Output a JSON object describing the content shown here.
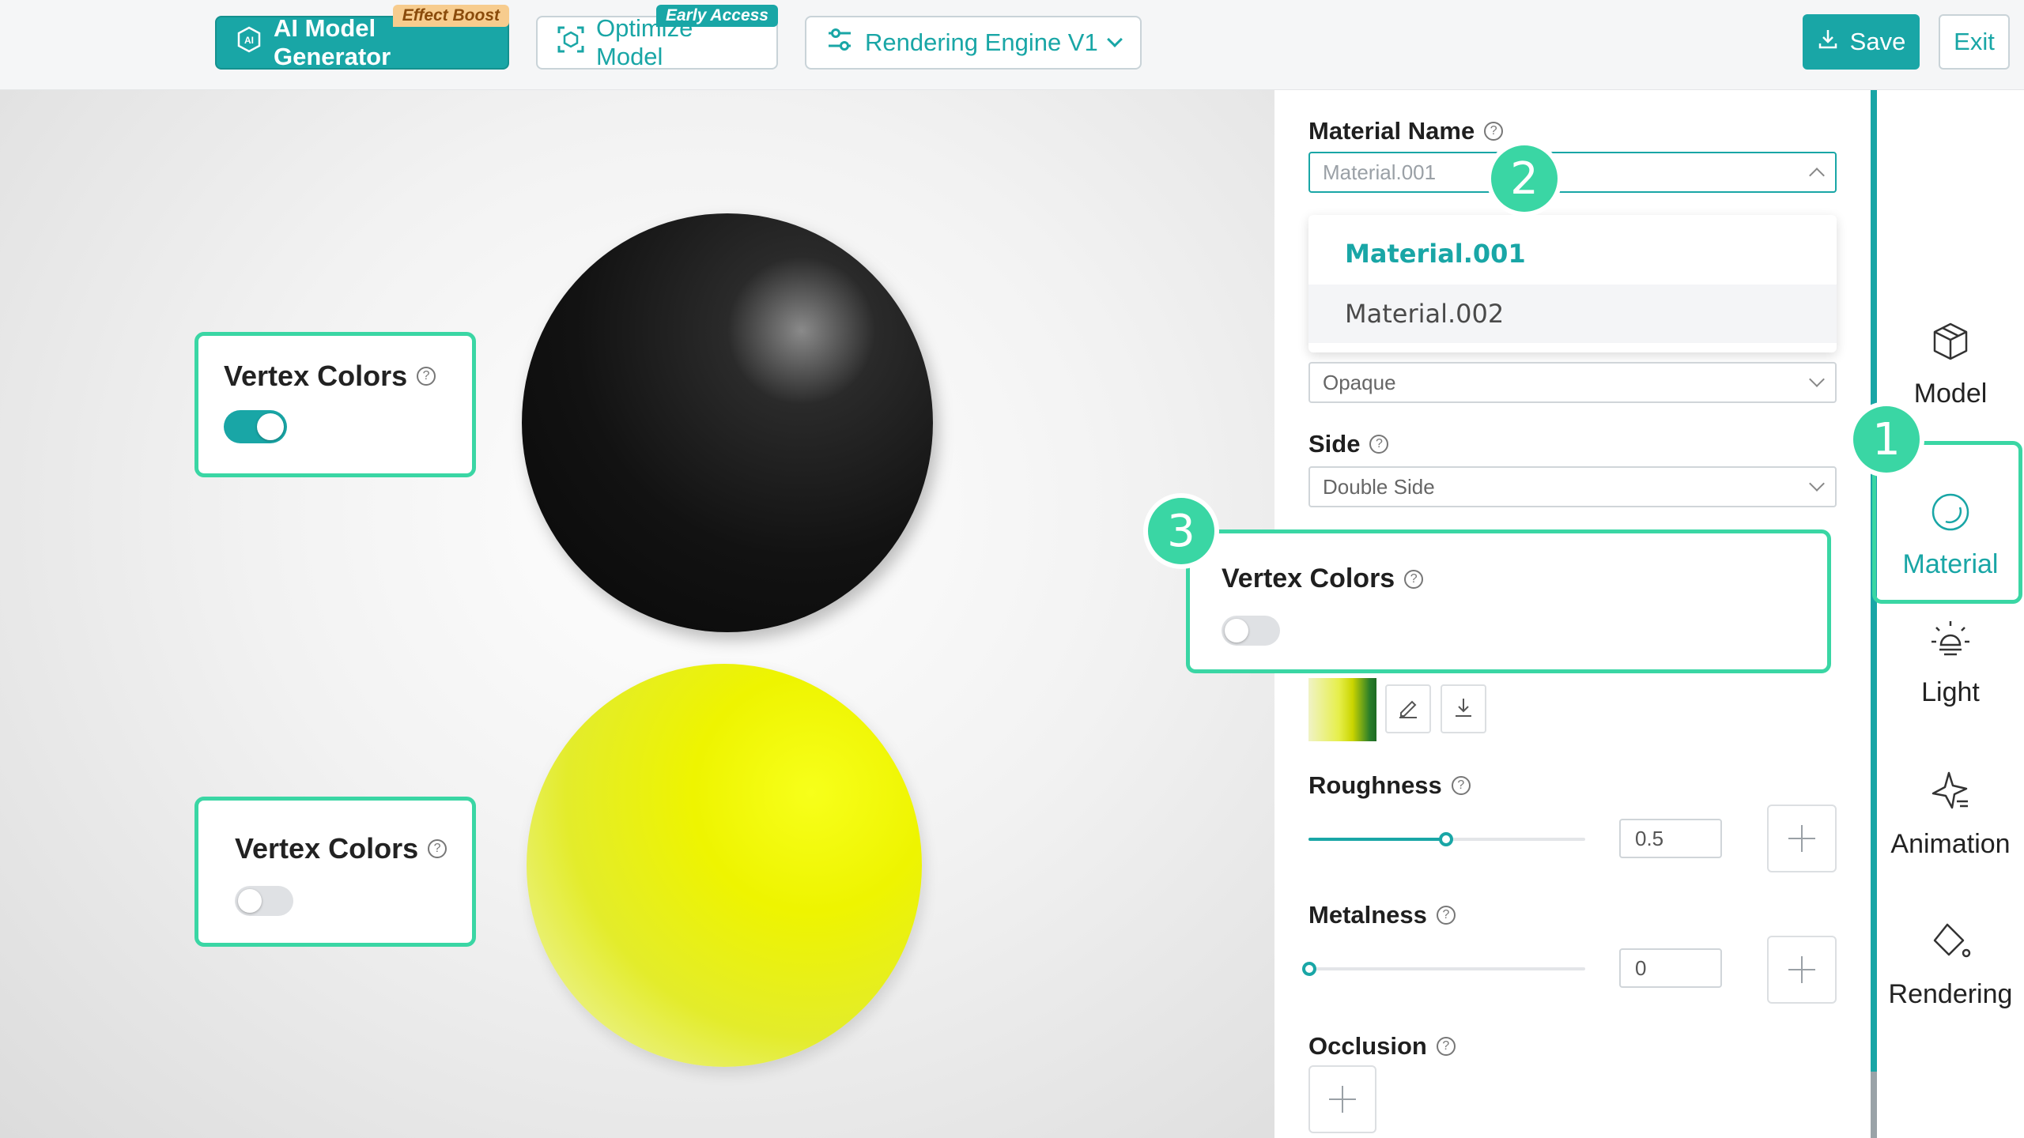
{
  "topbar": {
    "ai_generator_label": "AI Model Generator",
    "ai_generator_tag": "Effect Boost",
    "optimize_label": "Optimize Model",
    "optimize_tag": "Early Access",
    "engine_label": "Rendering Engine V1",
    "save_label": "Save",
    "exit_label": "Exit"
  },
  "viewport": {
    "card_top": {
      "title": "Vertex Colors",
      "enabled": true
    },
    "card_bottom": {
      "title": "Vertex Colors",
      "enabled": false
    }
  },
  "panel": {
    "material_name_label": "Material Name",
    "material_select_value": "Material.001",
    "material_options": [
      "Material.001",
      "Material.002"
    ],
    "blend_select_value": "Opaque",
    "side_label": "Side",
    "side_select_value": "Double Side",
    "vertex_colors_label": "Vertex Colors",
    "vertex_colors_enabled": false,
    "roughness_label": "Roughness",
    "roughness_value": "0.5",
    "metalness_label": "Metalness",
    "metalness_value": "0",
    "occlusion_label": "Occlusion"
  },
  "sidebar": {
    "items": [
      {
        "label": "Model",
        "icon": "cube-icon"
      },
      {
        "label": "Material",
        "icon": "material-sphere-icon",
        "active": true
      },
      {
        "label": "Light",
        "icon": "lightbulb-icon"
      },
      {
        "label": "Animation",
        "icon": "sparkle-icon"
      },
      {
        "label": "Rendering",
        "icon": "paint-bucket-icon"
      }
    ]
  },
  "callouts": {
    "one": "1",
    "two": "2",
    "three": "3"
  },
  "colors": {
    "accent": "#19a6a6",
    "callout": "#3ad6a4",
    "tag_orange": "#f7cc8e"
  }
}
